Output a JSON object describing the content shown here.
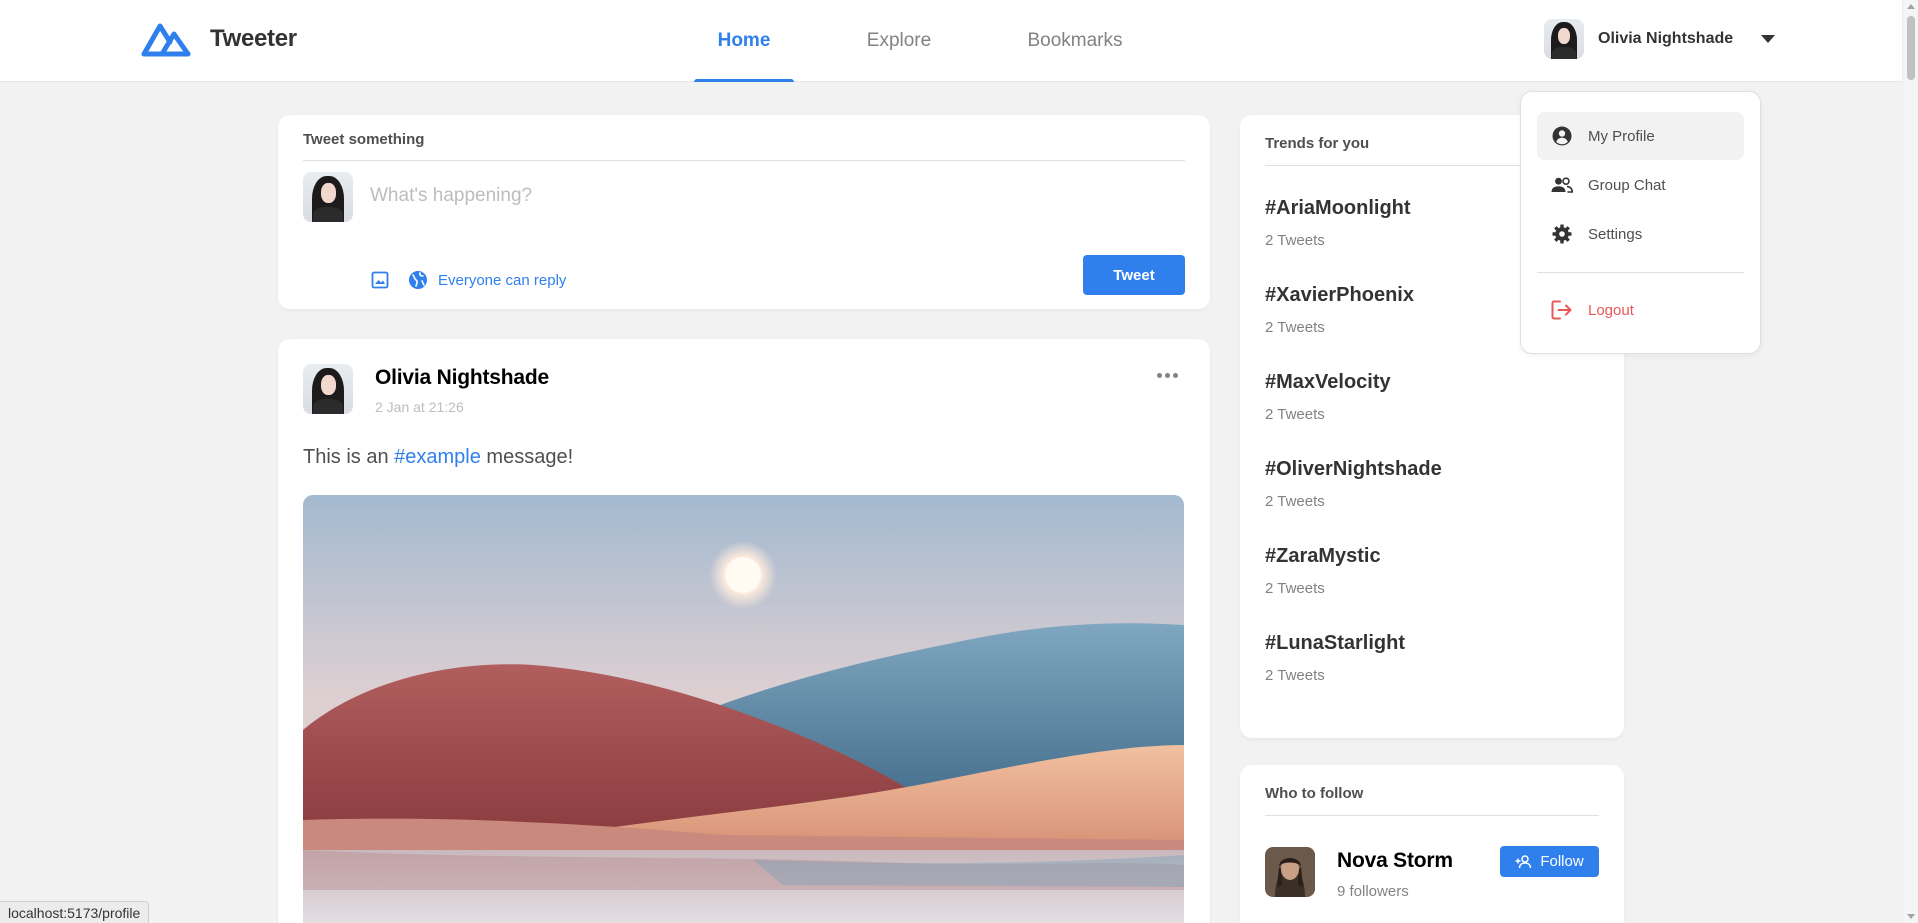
{
  "brand": {
    "name": "Tweeter",
    "color": "#2f80ed"
  },
  "nav": {
    "tabs": [
      {
        "label": "Home",
        "active": true
      },
      {
        "label": "Explore",
        "active": false
      },
      {
        "label": "Bookmarks",
        "active": false
      }
    ]
  },
  "user": {
    "name": "Olivia Nightshade"
  },
  "dropdown": {
    "items": [
      {
        "label": "My Profile",
        "icon": "account-circle-icon"
      },
      {
        "label": "Group Chat",
        "icon": "group-icon"
      },
      {
        "label": "Settings",
        "icon": "gear-icon"
      },
      {
        "label": "Logout",
        "icon": "logout-icon"
      }
    ]
  },
  "compose": {
    "title": "Tweet something",
    "placeholder": "What's happening?",
    "reply_setting": "Everyone can reply",
    "submit_label": "Tweet"
  },
  "post": {
    "author": "Olivia Nightshade",
    "time": "2 Jan at 21:26",
    "text_before": "This is an ",
    "hashtag": "#example",
    "text_after": " message!"
  },
  "trends": {
    "title": "Trends for you",
    "items": [
      {
        "tag": "#AriaMoonlight",
        "count": "2 Tweets"
      },
      {
        "tag": "#XavierPhoenix",
        "count": "2 Tweets"
      },
      {
        "tag": "#MaxVelocity",
        "count": "2 Tweets"
      },
      {
        "tag": "#OliverNightshade",
        "count": "2 Tweets"
      },
      {
        "tag": "#ZaraMystic",
        "count": "2 Tweets"
      },
      {
        "tag": "#LunaStarlight",
        "count": "2 Tweets"
      }
    ]
  },
  "who_to_follow": {
    "title": "Who to follow",
    "name": "Nova Storm",
    "followers": "9 followers",
    "button_label": "Follow"
  },
  "status_bar": {
    "url": "localhost:5173/profile"
  },
  "colors": {
    "accent": "#2f80ed",
    "danger": "#eb5757",
    "background": "#f2f2f2"
  }
}
